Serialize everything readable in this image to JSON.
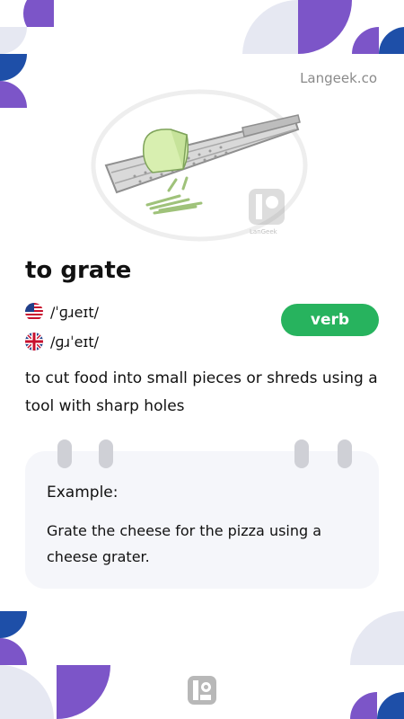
{
  "brand": {
    "site": "Langeek.co",
    "watermark": "LanGeek",
    "colors": {
      "purple": "#7c55c8",
      "blue": "#1e4fa8",
      "lavender": "#e6e8f2",
      "green": "#27b35e"
    }
  },
  "entry": {
    "word": "to grate",
    "pronunciations": [
      {
        "flag": "us-flag-icon",
        "ipa": "/ˈɡɹeɪt/"
      },
      {
        "flag": "uk-flag-icon",
        "ipa": "/ɡɹˈeɪt/"
      }
    ],
    "part_of_speech": "verb",
    "definition": "to cut food into small pieces or shreds using a tool with sharp holes"
  },
  "example": {
    "label": "Example:",
    "text": "Grate the cheese for the pizza using a cheese grater."
  }
}
